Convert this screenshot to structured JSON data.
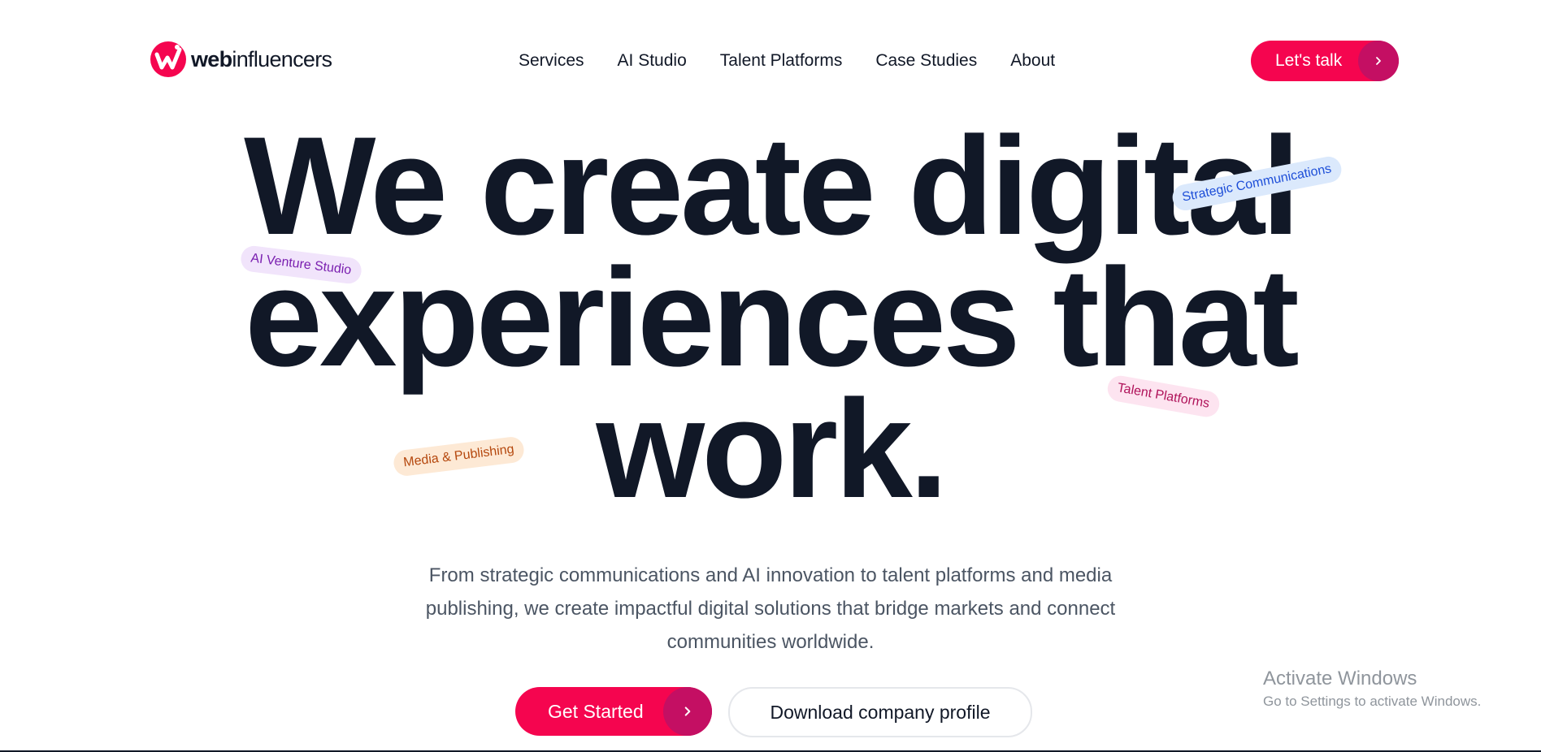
{
  "brand": {
    "name_bold": "web",
    "name_rest": "influencers",
    "accent": "#f5054f",
    "accent_dark": "#c40f63"
  },
  "nav": {
    "items": [
      {
        "label": "Services"
      },
      {
        "label": "AI Studio"
      },
      {
        "label": "Talent Platforms"
      },
      {
        "label": "Case Studies"
      },
      {
        "label": "About"
      }
    ],
    "cta_label": "Let's talk",
    "cta_icon": "chevron-right-icon"
  },
  "hero": {
    "line1": "We create digital",
    "line2": "experiences that",
    "line3": "work.",
    "tags": {
      "ai_venture": "AI Venture Studio",
      "strategic": "Strategic Communications",
      "talent": "Talent Platforms",
      "media": "Media & Publishing"
    },
    "subtitle": "From strategic communications and AI innovation to talent platforms and media publishing, we create impactful digital solutions that bridge markets and connect communities worldwide.",
    "primary_cta": "Get Started",
    "secondary_cta": "Download company profile"
  },
  "os_watermark": {
    "title": "Activate Windows",
    "subtitle": "Go to Settings to activate Windows."
  }
}
